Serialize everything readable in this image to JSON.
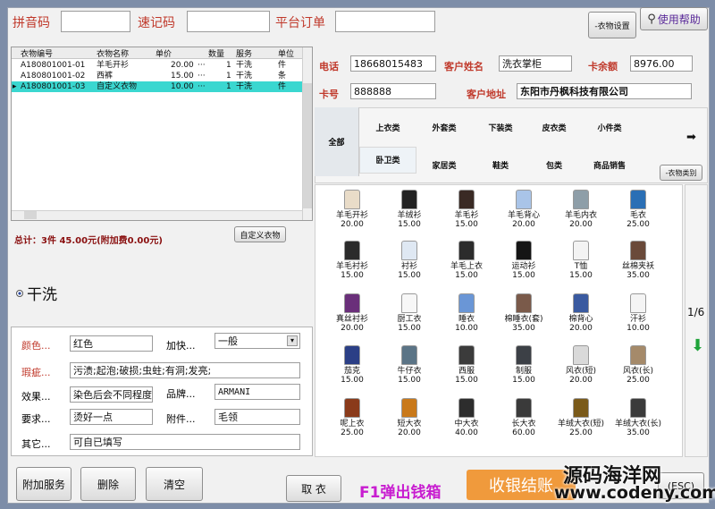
{
  "top": {
    "pinyin_label": "拼音码",
    "quick_label": "速记码",
    "platform_label": "平台订单",
    "cloth_settings": "-衣物设置",
    "help": "使用帮助"
  },
  "grid": {
    "headers": [
      "衣物编号",
      "衣物名称",
      "单价",
      "数量",
      "服务",
      "单位"
    ],
    "rows": [
      {
        "no": "A180801001-01",
        "name": "羊毛开衫",
        "price": "20.00",
        "ell": "···",
        "qty": "1",
        "svc": "干洗",
        "unit": "件"
      },
      {
        "no": "A180801001-02",
        "name": "西裤",
        "price": "15.00",
        "ell": "···",
        "qty": "1",
        "svc": "干洗",
        "unit": "条"
      },
      {
        "no": "A180801001-03",
        "name": "自定义衣物",
        "price": "10.00",
        "ell": "···",
        "qty": "1",
        "svc": "干洗",
        "unit": "件",
        "marker": "▸"
      }
    ]
  },
  "totals": {
    "text": "总计：3件  45.00元(附加费0.00元)",
    "custom_btn": "自定义衣物"
  },
  "service": {
    "label": "干洗"
  },
  "form": {
    "color_label": "颜色...",
    "color_value": "红色",
    "urgent_label": "加快...",
    "urgent_value": "一般",
    "defect_label": "瑕疵...",
    "defect_value": "污渍;起泡;破损;虫蛀;有洞;发亮;",
    "effect_label": "效果...",
    "effect_value": "染色后会不同程度",
    "brand_label": "品牌...",
    "brand_value": "ARMANI",
    "req_label": "要求...",
    "req_value": "烫好一点",
    "attach_label": "附件...",
    "attach_value": "毛领",
    "other_label": "其它...",
    "other_value": "可自已填写"
  },
  "customer": {
    "phone_label": "电话",
    "phone": "18668015483",
    "name_label": "客户姓名",
    "name": "洗衣掌柜",
    "balance_label": "卡余额",
    "balance": "8976.00",
    "card_label": "卡号",
    "card": "888888",
    "addr_label": "客户地址",
    "addr": "东阳市丹枫科技有限公司"
  },
  "categories": {
    "all": "全部",
    "row1": [
      "上衣类",
      "外套类",
      "下装类",
      "皮衣类",
      "小件类"
    ],
    "row2": [
      "卧卫类",
      "家居类",
      "鞋类",
      "包类",
      "商品销售"
    ],
    "btn": "-衣物类别",
    "arrow": "➡"
  },
  "items": [
    {
      "name": "羊毛开衫",
      "price": "20.00",
      "color": "#e9dcc8"
    },
    {
      "name": "羊绒衫",
      "price": "15.00",
      "color": "#222222"
    },
    {
      "name": "羊毛衫",
      "price": "15.00",
      "color": "#3a2a24"
    },
    {
      "name": "羊毛背心",
      "price": "20.00",
      "color": "#a9c4e8"
    },
    {
      "name": "羊毛内衣",
      "price": "20.00",
      "color": "#8e9ea8"
    },
    {
      "name": "毛衣",
      "price": "25.00",
      "color": "#2a6fb5"
    },
    {
      "name": "羊毛衬衫",
      "price": "15.00",
      "color": "#2b2b2b"
    },
    {
      "name": "衬衫",
      "price": "15.00",
      "color": "#dfe8f3"
    },
    {
      "name": "羊毛上衣",
      "price": "15.00",
      "color": "#2c2c2c"
    },
    {
      "name": "运动衫",
      "price": "15.00",
      "color": "#151515"
    },
    {
      "name": "T恤",
      "price": "15.00",
      "color": "#f3f3f3"
    },
    {
      "name": "丝棉夹袄",
      "price": "35.00",
      "color": "#6a4a3a"
    },
    {
      "name": "真丝衬衫",
      "price": "20.00",
      "color": "#6a2f7a"
    },
    {
      "name": "厨工衣",
      "price": "15.00",
      "color": "#f7f7f7"
    },
    {
      "name": "睡衣",
      "price": "10.00",
      "color": "#6a96d6"
    },
    {
      "name": "棉睡衣(套)",
      "price": "35.00",
      "color": "#7a5a4a"
    },
    {
      "name": "棉背心",
      "price": "20.00",
      "color": "#3a5aa0"
    },
    {
      "name": "汗衫",
      "price": "10.00",
      "color": "#f4f4f4"
    },
    {
      "name": "茄克",
      "price": "15.00",
      "color": "#2b3f86"
    },
    {
      "name": "牛仔衣",
      "price": "15.00",
      "color": "#5b7486"
    },
    {
      "name": "西服",
      "price": "15.00",
      "color": "#3b3b3b"
    },
    {
      "name": "制服",
      "price": "15.00",
      "color": "#3c4046"
    },
    {
      "name": "风衣(短)",
      "price": "20.00",
      "color": "#d9d9d9"
    },
    {
      "name": "风衣(长)",
      "price": "25.00",
      "color": "#a58a6a"
    },
    {
      "name": "呢上衣",
      "price": "25.00",
      "color": "#8a3a1a"
    },
    {
      "name": "短大衣",
      "price": "20.00",
      "color": "#c9791a"
    },
    {
      "name": "中大衣",
      "price": "40.00",
      "color": "#2d2d2d"
    },
    {
      "name": "长大衣",
      "price": "60.00",
      "color": "#3a3a3a"
    },
    {
      "name": "羊绒大衣(短)",
      "price": "25.00",
      "color": "#7a5a1a"
    },
    {
      "name": "羊绒大衣(长)",
      "price": "35.00",
      "color": "#3b3b3b"
    }
  ],
  "pager": {
    "page": "1/6"
  },
  "bottom": {
    "extra": "附加服务",
    "delete": "删除",
    "clear": "清空",
    "cancel": "取 衣",
    "f1": "F1弹出钱箱",
    "checkout": "收银结账",
    "exit": "(ESC)"
  },
  "watermark": {
    "line1": "源码海洋网",
    "line2": "www.codeny.com"
  }
}
